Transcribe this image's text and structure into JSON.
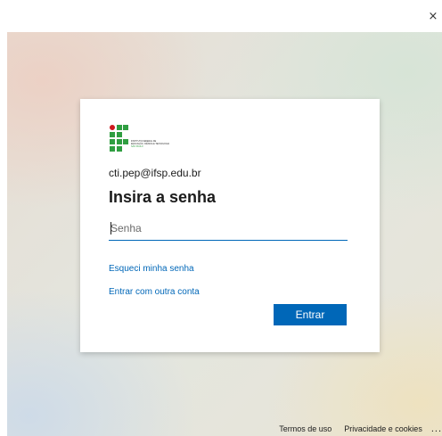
{
  "window": {
    "close_glyph": "×"
  },
  "signin": {
    "logo_text": [
      "INSTITUTO FEDERAL DE",
      "EDUCAÇÃO, CIÊNCIA E TECNOLOGIA",
      "SÃO PAULO"
    ],
    "email": "cti.pep@ifsp.edu.br",
    "heading": "Insira a senha",
    "password_placeholder": "Senha",
    "forgot_link": "Esqueci minha senha",
    "other_account_link": "Entrar com outra conta",
    "submit_label": "Entrar"
  },
  "footer": {
    "terms": "Termos de uso",
    "privacy": "Privacidade e cookies",
    "more": "..."
  },
  "colors": {
    "accent": "#0067b8",
    "logo_green": "#2f9e41",
    "logo_red": "#cd191e"
  }
}
